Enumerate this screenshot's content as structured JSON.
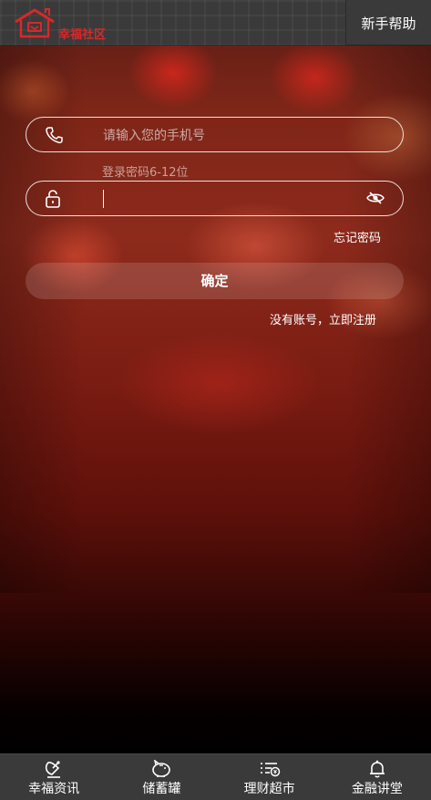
{
  "header": {
    "logo_text": "幸福社区",
    "help_label": "新手帮助"
  },
  "form": {
    "phone_placeholder": "请输入您的手机号",
    "password_hint": "登录密码6-12位",
    "forgot_label": "忘记密码",
    "confirm_label": "确定",
    "register_label": "没有账号，立即注册"
  },
  "tabbar": {
    "items": [
      {
        "label": "幸福资讯",
        "icon": "satellite-dish-icon"
      },
      {
        "label": "储蓄罐",
        "icon": "piggy-bank-icon"
      },
      {
        "label": "理财超市",
        "icon": "list-coin-icon"
      },
      {
        "label": "金融讲堂",
        "icon": "bell-icon"
      }
    ]
  },
  "colors": {
    "header_bg": "#3a3a3a",
    "brand_red": "#d7282a",
    "tabbar_bg": "#3a3a3a"
  }
}
